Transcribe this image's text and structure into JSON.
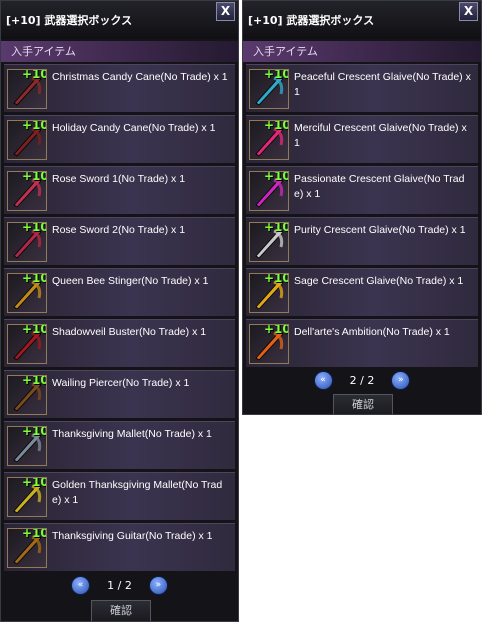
{
  "left": {
    "title": "[+10] 武器選択ボックス",
    "close": "X",
    "section": "入手アイテム",
    "items": [
      {
        "name": "Christmas Candy Cane(No Trade) x 1",
        "plus": "+10",
        "color": "#8a2a2a"
      },
      {
        "name": "Holiday Candy Cane(No Trade) x 1",
        "plus": "+10",
        "color": "#7a2020"
      },
      {
        "name": "Rose Sword 1(No Trade) x 1",
        "plus": "+10",
        "color": "#c03050"
      },
      {
        "name": "Rose Sword 2(No Trade) x 1",
        "plus": "+10",
        "color": "#b02848"
      },
      {
        "name": "Queen Bee Stinger(No Trade) x 1",
        "plus": "+10",
        "color": "#c08a18"
      },
      {
        "name": "Shadowveil Buster(No Trade) x 1",
        "plus": "+10",
        "color": "#a01820"
      },
      {
        "name": "Wailing Piercer(No Trade) x 1",
        "plus": "+10",
        "color": "#7a4a20"
      },
      {
        "name": "Thanksgiving Mallet(No Trade) x 1",
        "plus": "+10",
        "color": "#7a8a9a"
      },
      {
        "name": "Golden Thanksgiving Mallet(No Trade) x 1",
        "plus": "+10",
        "color": "#c8b020"
      },
      {
        "name": "Thanksgiving Guitar(No Trade) x 1",
        "plus": "+10",
        "color": "#a06818"
      }
    ],
    "pager": {
      "prev": "«",
      "pages": "1 / 2",
      "next": "»"
    },
    "confirm": "確認"
  },
  "right": {
    "title": "[+10] 武器選択ボックス",
    "close": "X",
    "section": "入手アイテム",
    "items": [
      {
        "name": "Peaceful Crescent Glaive(No Trade) x 1",
        "plus": "+10",
        "color": "#30a8c8"
      },
      {
        "name": "Merciful Crescent Glaive(No Trade) x 1",
        "plus": "+10",
        "color": "#e02878"
      },
      {
        "name": "Passionate Crescent Glaive(No Trade) x 1",
        "plus": "+10",
        "color": "#c828c0"
      },
      {
        "name": "Purity Crescent Glaive(No Trade) x 1",
        "plus": "+10",
        "color": "#c8c8c8"
      },
      {
        "name": "Sage Crescent Glaive(No Trade) x 1",
        "plus": "+10",
        "color": "#e0a818"
      },
      {
        "name": "Dell'arte's Ambition(No Trade) x 1",
        "plus": "+10",
        "color": "#e06018"
      }
    ],
    "pager": {
      "prev": "«",
      "pages": "2 / 2",
      "next": "»"
    },
    "confirm": "確認"
  }
}
